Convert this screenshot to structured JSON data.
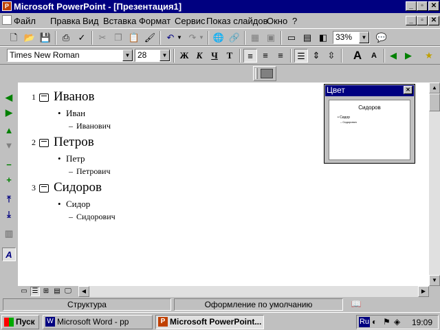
{
  "window": {
    "title": "Microsoft PowerPoint - [Презентация1]"
  },
  "menu": [
    "Файл",
    "Правка",
    "Вид",
    "Вставка",
    "Формат",
    "Сервис",
    "Показ слайдов",
    "Окно",
    "?"
  ],
  "standard_toolbar": {
    "zoom": "33%"
  },
  "format_toolbar": {
    "font_name": "Times New Roman",
    "font_size": "28",
    "bold": "Ж",
    "italic": "К",
    "underline": "Ч",
    "shadow": "Т"
  },
  "outline": [
    {
      "number": "1",
      "title": "Иванов",
      "bullet": "Иван",
      "sub": "Иванович"
    },
    {
      "number": "2",
      "title": "Петров",
      "bullet": "Петр",
      "sub": "Петрович"
    },
    {
      "number": "3",
      "title": "Сидоров",
      "bullet": "Сидор",
      "sub": "Сидорович"
    }
  ],
  "color_panel": {
    "caption": "Цвет",
    "preview_title": "Сидоров",
    "preview_bullet": "Сидор",
    "preview_sub": "Сидорович"
  },
  "status": {
    "view": "Структура",
    "design": "Оформление по умолчанию"
  },
  "taskbar": {
    "start": "Пуск",
    "items": [
      "Microsoft Word - pp",
      "Microsoft PowerPoint..."
    ],
    "lang": "Ru",
    "clock": "19:09"
  }
}
